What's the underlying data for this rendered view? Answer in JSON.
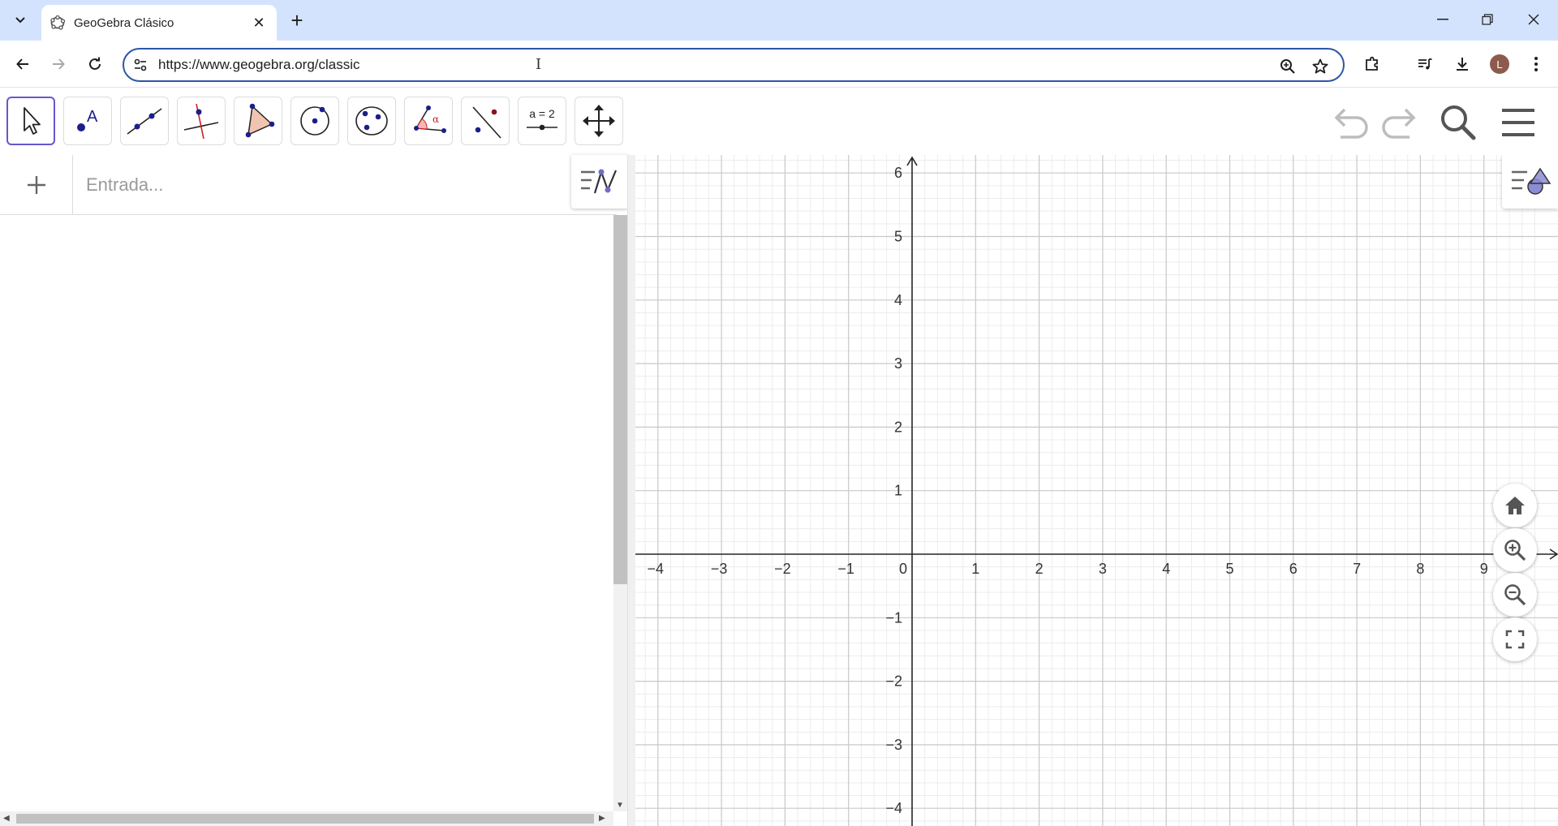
{
  "browser": {
    "tab": {
      "title": "GeoGebra Clásico"
    },
    "url": "https://www.geogebra.org/classic",
    "avatar_letter": "L"
  },
  "geogebra": {
    "tools": [
      {
        "name": "move",
        "icon": "move-pointer-icon"
      },
      {
        "name": "point",
        "icon": "point-icon"
      },
      {
        "name": "line",
        "icon": "line-icon"
      },
      {
        "name": "perpendicular-line",
        "icon": "perpendicular-line-icon"
      },
      {
        "name": "polygon",
        "icon": "polygon-icon"
      },
      {
        "name": "circle-center-point",
        "icon": "circle-icon"
      },
      {
        "name": "ellipse",
        "icon": "ellipse-icon"
      },
      {
        "name": "angle",
        "icon": "angle-icon"
      },
      {
        "name": "reflect",
        "icon": "reflect-icon"
      },
      {
        "name": "slider",
        "icon": "slider-icon"
      },
      {
        "name": "move-graphics-view",
        "icon": "move-view-icon"
      }
    ],
    "slider_tool_label": "a = 2",
    "angle_symbol": "α",
    "algebra": {
      "input_placeholder": "Entrada..."
    },
    "graphics": {
      "x_ticks": [
        "−4",
        "−3",
        "−2",
        "−1",
        "0",
        "1",
        "2",
        "3",
        "4",
        "5",
        "6",
        "7",
        "8",
        "9"
      ],
      "y_ticks": [
        "6",
        "5",
        "4",
        "3",
        "2",
        "1",
        "−1",
        "−2",
        "−3",
        "−4"
      ],
      "x_range": [
        -4.3,
        9.9
      ],
      "y_range": [
        -4.2,
        6.3
      ],
      "grid": true,
      "colors": {
        "major": "#c8c8c8",
        "minor": "#ececec",
        "axis": "#252525"
      }
    }
  }
}
